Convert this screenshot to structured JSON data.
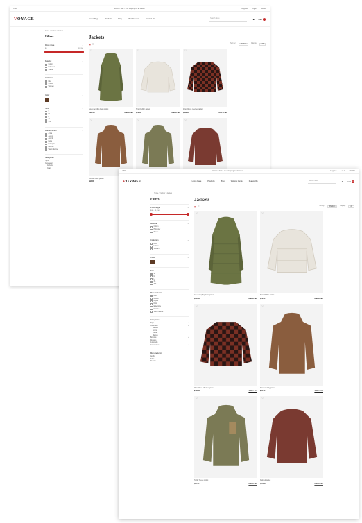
{
  "topbar": {
    "currency": "USD",
    "promo": "Summer Sale – free shipping on all orders",
    "register": "Register",
    "login": "Log in",
    "wishlist": "Wishlist"
  },
  "brand": {
    "logo_v": "V",
    "logo_rest": "OYAGE"
  },
  "nav": [
    "Home Page",
    "Products",
    "Blog",
    "Manufacturers",
    "Contact Us"
  ],
  "nav_front": [
    "Home Page",
    "Products",
    "Blog",
    "Website Guide",
    "Feature Re"
  ],
  "search_placeholder": "Search Store",
  "cart": {
    "label": "Cart",
    "count": "0"
  },
  "breadcrumb": "Home / Outdoor / Jackets",
  "filters": {
    "title": "Filters",
    "price": {
      "label": "Price range",
      "value": "$40 – $1,150",
      "min": "$0",
      "max": "$1,150"
    },
    "material": {
      "label": "Material",
      "items": [
        "Cotton",
        "Polyester",
        "Suede"
      ]
    },
    "collection": {
      "label": "Collection",
      "items": [
        "Men",
        "Unisex",
        "Women"
      ]
    },
    "color": {
      "label": "Color",
      "swatch": "#5d3a24"
    },
    "size": {
      "label": "Size",
      "items": [
        "S",
        "M",
        "L",
        "XL",
        "XXL"
      ]
    },
    "manufacturers": {
      "label": "Manufacturers",
      "items": [
        "Arma",
        "Avenor",
        "Aspirit",
        "Delta",
        "Enterprise",
        "Fiorone",
        "Warm Marine"
      ]
    }
  },
  "categories": {
    "label": "Categories",
    "items": [
      {
        "name": "Tops",
        "sub": false
      },
      {
        "name": "Outerwear",
        "sub": false
      },
      {
        "name": "Jackets",
        "sub": true
      },
      {
        "name": "Coats",
        "sub": true
      },
      {
        "name": "Parkas",
        "sub": true
      },
      {
        "name": "Blazers",
        "sub": true
      },
      {
        "name": "Bottoms",
        "sub": false
      },
      {
        "name": "Dresses",
        "sub": false
      },
      {
        "name": "Jumpsuits",
        "sub": false
      },
      {
        "name": "Accessories",
        "sub": false
      }
    ]
  },
  "manufacturers_block": {
    "label": "Manufacturers",
    "items": [
      "Apollo",
      "Echo",
      "Deardo"
    ]
  },
  "main": {
    "title": "Jackets",
    "sort_label": "Sort by:",
    "sort_value": "Position",
    "display_label": "Display:",
    "display_value": "24"
  },
  "products": [
    {
      "name": "Green lengthy down jacket",
      "price": "$185.00",
      "cart": "Add to cart",
      "color": "#6b7443"
    },
    {
      "name": "Short Puffer Jacket",
      "price": "$79.00",
      "cart": "Add to cart",
      "color": "#e8e4dc"
    },
    {
      "name": "Wool-blend checked jacket",
      "price": "$139.00",
      "cart": "Add to cart",
      "color": "#4a2620"
    },
    {
      "name": "Hooded utility jacket",
      "price": "$92.00",
      "cart": "Add to cart",
      "color": "#8a5d3e"
    },
    {
      "name": "Teddy fleece jacket",
      "price": "$65.00",
      "cart": "Add to cart",
      "color": "#7b7a55"
    },
    {
      "name": "Padded jacket",
      "price": "$110.00",
      "cart": "Add to cart",
      "color": "#7a3a31"
    }
  ]
}
